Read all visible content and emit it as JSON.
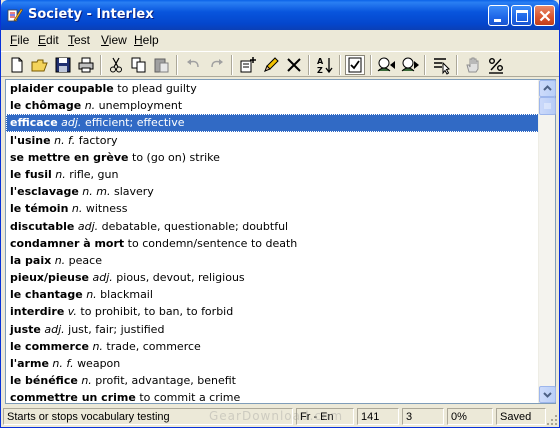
{
  "window": {
    "title": "Society - Interlex"
  },
  "menu": {
    "file": "File",
    "edit": "Edit",
    "test": "Test",
    "view": "View",
    "help": "Help"
  },
  "toolbar_icons": [
    "new-file-icon",
    "open-folder-icon",
    "save-icon",
    "print-icon",
    "cut-icon",
    "copy-icon",
    "paste-icon",
    "undo-icon",
    "redo-icon",
    "add-entry-icon",
    "edit-pencil-icon",
    "delete-x-icon",
    "sort-az-icon",
    "checklist-icon",
    "test-backward-icon",
    "test-forward-icon",
    "select-list-icon",
    "hand-icon",
    "percent-icon"
  ],
  "entries": [
    {
      "term": "plaider coupable",
      "pos": "",
      "def": "to plead guilty"
    },
    {
      "term": "le chômage",
      "pos": "n.",
      "def": "unemployment"
    },
    {
      "term": "efficace",
      "pos": "adj.",
      "def": "efficient; effective"
    },
    {
      "term": "l'usine",
      "pos": "n. f.",
      "def": "factory"
    },
    {
      "term": "se mettre en grève",
      "pos": "",
      "def": "to (go on) strike"
    },
    {
      "term": "le fusil",
      "pos": "n.",
      "def": "rifle, gun"
    },
    {
      "term": "l'esclavage",
      "pos": "n. m.",
      "def": "slavery"
    },
    {
      "term": "le témoin",
      "pos": "n.",
      "def": "witness"
    },
    {
      "term": "discutable",
      "pos": "adj.",
      "def": "debatable, questionable; doubtful"
    },
    {
      "term": "condamner à mort",
      "pos": "",
      "def": "to condemn/sentence to death"
    },
    {
      "term": "la paix",
      "pos": "n.",
      "def": "peace"
    },
    {
      "term": "pieux/pieuse",
      "pos": "adj.",
      "def": "pious, devout, religious"
    },
    {
      "term": "le chantage",
      "pos": "n.",
      "def": "blackmail"
    },
    {
      "term": "interdire",
      "pos": "v.",
      "def": "to prohibit, to ban, to forbid"
    },
    {
      "term": "juste",
      "pos": "adj.",
      "def": "just, fair; justified"
    },
    {
      "term": "le commerce",
      "pos": "n.",
      "def": "trade, commerce"
    },
    {
      "term": "l'arme",
      "pos": "n. f.",
      "def": "weapon"
    },
    {
      "term": "le bénéfice",
      "pos": "n.",
      "def": "profit, advantage, benefit"
    },
    {
      "term": "commettre un crime",
      "pos": "",
      "def": "to commit a crime"
    }
  ],
  "selected_index": 2,
  "status": {
    "message": "Starts or stops vocabulary testing",
    "languages": "Fr - En",
    "count": "141",
    "position": "3",
    "percent": "0%",
    "state": "Saved"
  },
  "watermark": "GearDownload.com",
  "colors": {
    "selection": "#316AC5",
    "titlebar": "#0855DD",
    "face": "#ECE9D8"
  }
}
